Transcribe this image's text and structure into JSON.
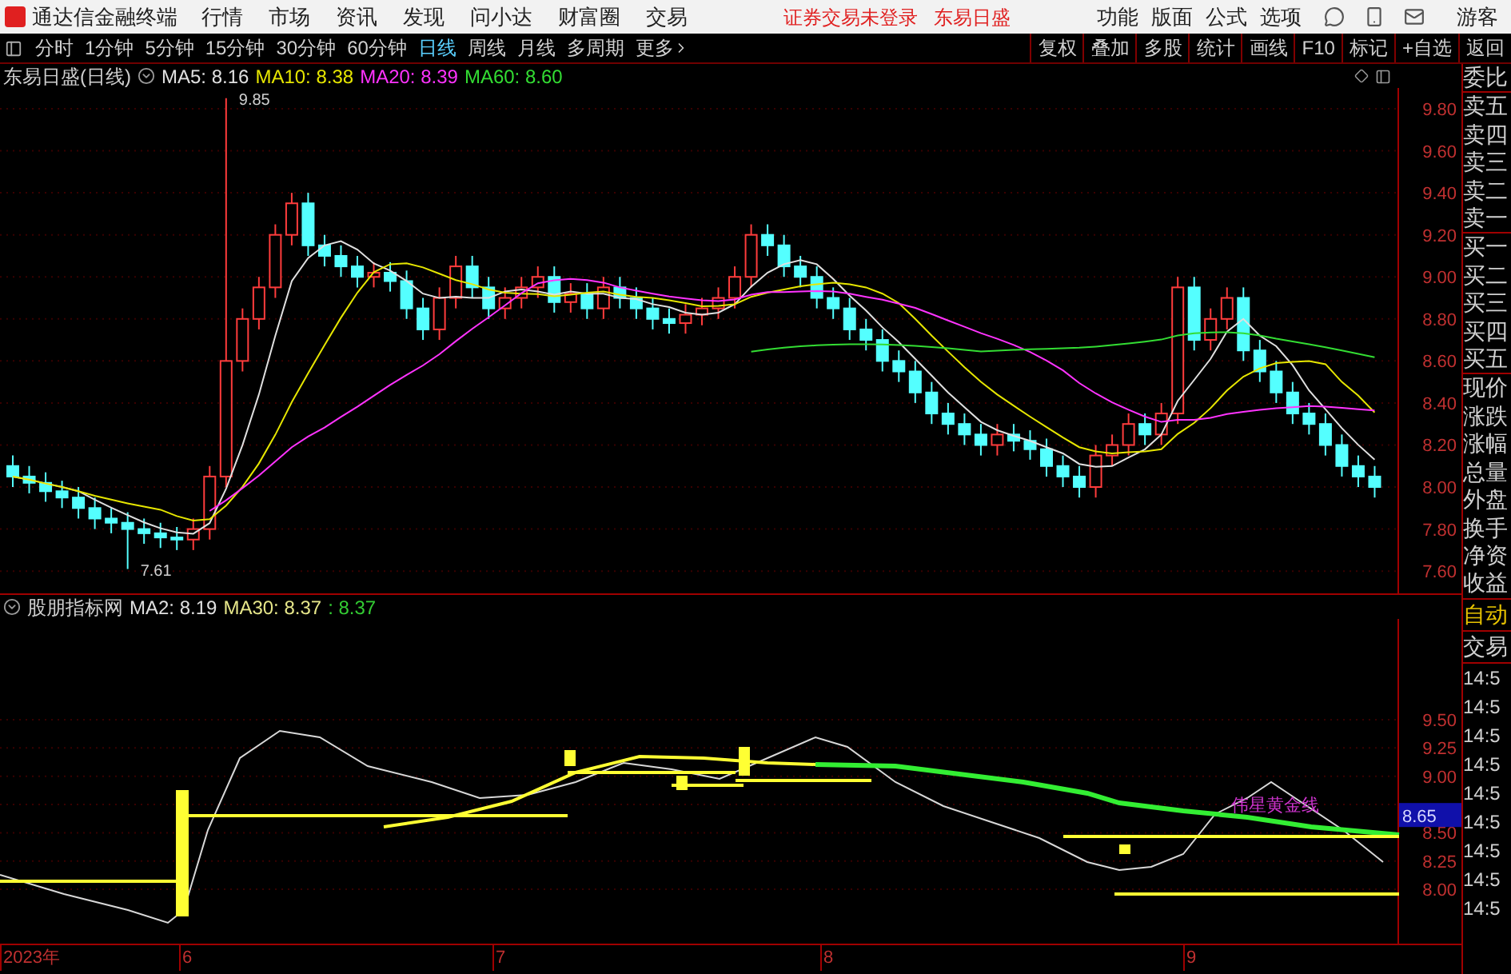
{
  "title_bar": {
    "app_name": "通达信金融终端",
    "menu": [
      "行情",
      "市场",
      "资讯",
      "发现",
      "问小达",
      "财富圈",
      "交易"
    ],
    "notices": [
      "证券交易未登录",
      "东易日盛"
    ],
    "right_menu": [
      "功能",
      "版面",
      "公式",
      "选项"
    ],
    "user": "游客"
  },
  "toolbar": {
    "periods": [
      {
        "label": "分时",
        "selected": false
      },
      {
        "label": "1分钟",
        "selected": false
      },
      {
        "label": "5分钟",
        "selected": false
      },
      {
        "label": "15分钟",
        "selected": false
      },
      {
        "label": "30分钟",
        "selected": false
      },
      {
        "label": "60分钟",
        "selected": false
      },
      {
        "label": "日线",
        "selected": true
      },
      {
        "label": "周线",
        "selected": false
      },
      {
        "label": "月线",
        "selected": false
      },
      {
        "label": "多周期",
        "selected": false
      },
      {
        "label": "更多",
        "selected": false
      }
    ],
    "buttons": [
      "复权",
      "叠加",
      "多股",
      "统计",
      "画线",
      "F10",
      "标记",
      "+自选",
      "返回"
    ]
  },
  "price_chart": {
    "name": "东易日盛(日线)",
    "indicators": [
      {
        "text": "MA5: 8.16",
        "color": "#e0e0e0"
      },
      {
        "text": "MA10: 8.38",
        "color": "#e6e600"
      },
      {
        "text": "MA20: 8.39",
        "color": "#ff33ff"
      },
      {
        "text": "MA60: 8.60",
        "color": "#33dd33"
      }
    ],
    "y_axis": [
      "9.80",
      "9.60",
      "9.40",
      "9.20",
      "9.00",
      "8.80",
      "8.60",
      "8.40",
      "8.20",
      "8.00",
      "7.80",
      "7.60"
    ],
    "high_label": "9.85",
    "low_label": "7.61"
  },
  "indicator_chart": {
    "name": "股朋指标网",
    "indicators": [
      {
        "text": "MA2: 8.19",
        "color": "#e0e0e0"
      },
      {
        "text": "MA30: 8.37",
        "color": "#e6e68a"
      },
      {
        "text": ": 8.37",
        "color": "#33cc33"
      }
    ],
    "y_axis": [
      "9.50",
      "9.25",
      "9.00",
      "8.50",
      "8.25",
      "8.00"
    ],
    "current_value": "8.65",
    "line_label": "伟星黄金线"
  },
  "x_axis": [
    "2023年",
    "6",
    "7",
    "8",
    "9"
  ],
  "quote_panel": {
    "labels": [
      "委比",
      "卖五",
      "卖四",
      "卖三",
      "卖二",
      "卖一",
      "买一",
      "买二",
      "买三",
      "买四",
      "买五",
      "现价",
      "涨跌",
      "涨幅",
      "总量",
      "外盘",
      "换手",
      "净资",
      "收益"
    ],
    "mode": "自动",
    "trade_header": "交易",
    "times": [
      "14:5",
      "14:5",
      "14:5",
      "14:5",
      "14:5",
      "14:5",
      "14:5",
      "14:5",
      "14:5"
    ]
  }
}
